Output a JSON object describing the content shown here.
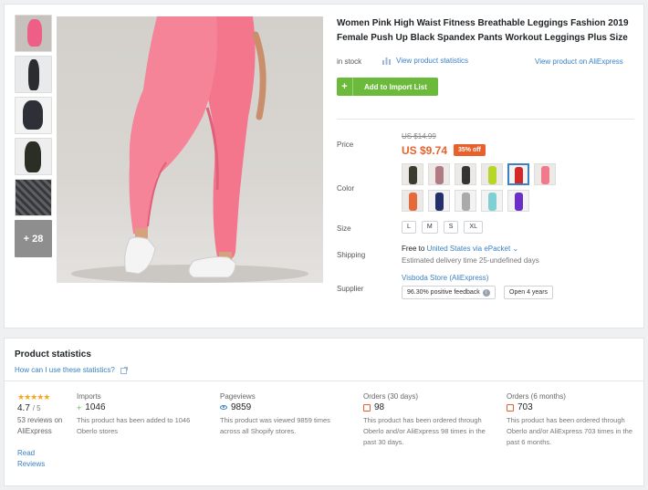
{
  "product": {
    "title": "Women Pink High Waist Fitness Breathable Leggings Fashion 2019 Female Push Up Black Spandex Pants Workout Leggings Plus Size",
    "stock": "in stock",
    "view_stats": "View product statistics",
    "view_ali": "View product on AliExpress",
    "add_button": "Add to Import List",
    "more_images": "+ 28"
  },
  "labels": {
    "price": "Price",
    "color": "Color",
    "size": "Size",
    "shipping": "Shipping",
    "supplier": "Supplier"
  },
  "price": {
    "old": "US $14.99",
    "current": "US $9.74",
    "discount": "35% off"
  },
  "sizes": [
    "L",
    "M",
    "S",
    "XL"
  ],
  "shipping": {
    "free_to": "Free to",
    "country": "United States",
    "via": "via",
    "method": "ePacket",
    "estimate": "Estimated delivery time 25-undefined days"
  },
  "supplier": {
    "name": "Visboda Store (AliExpress)",
    "feedback": "96.30% positive feedback",
    "open": "Open 4 years"
  },
  "stats": {
    "title": "Product statistics",
    "help": "How can I use these statistics?",
    "stars": "★★★★★",
    "rating": "4.7",
    "rating_of": "/ 5",
    "reviews": "53 reviews on AliExpress",
    "read_reviews": "Read Reviews",
    "imports": {
      "label": "Imports",
      "value": "1046",
      "desc": "This product has been added to 1046 Oberlo stores"
    },
    "pageviews": {
      "label": "Pageviews",
      "value": "9859",
      "desc": "This product was viewed 9859 times across all Shopify stores."
    },
    "orders30": {
      "label": "Orders (30 days)",
      "value": "98",
      "desc": "This product has been ordered through Oberlo and/or AliExpress 98 times in the past 30 days."
    },
    "orders6m": {
      "label": "Orders (6 months)",
      "value": "703",
      "desc": "This product has been ordered through Oberlo and/or AliExpress 703 times in the past 6 months."
    }
  },
  "colors": {
    "accent": "#3a82c4",
    "button": "#6bba3c",
    "price": "#e8612c",
    "star": "#f5a623",
    "legging_pink": "#f07a8a"
  }
}
